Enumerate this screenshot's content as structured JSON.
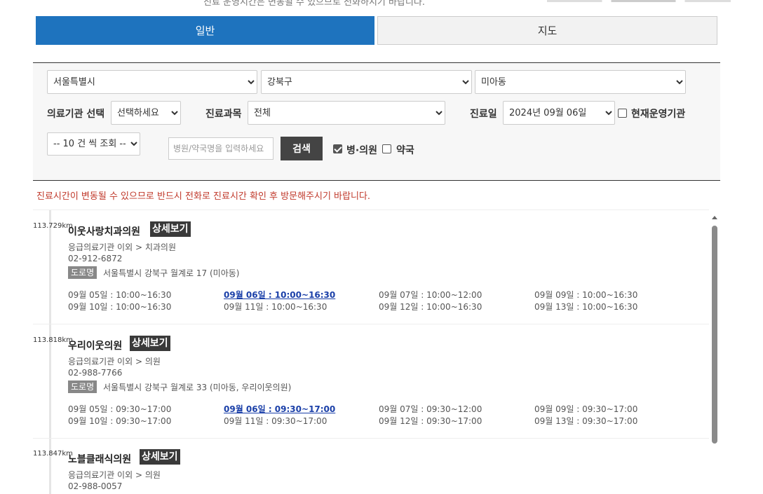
{
  "header": {
    "cut_text": "진료 운영시간은 변동될 수 있으므로 전화하시기 바랍니다."
  },
  "tabs": [
    {
      "label": "일반",
      "active": true
    },
    {
      "label": "지도",
      "active": false
    }
  ],
  "filters": {
    "sido": "서울특별시",
    "sigungu": "강북구",
    "dong": "미아동",
    "institution_label": "의료기관 선택",
    "institution_value": "선택하세요",
    "department_label": "진료과목",
    "department_value": "전체",
    "date_label": "진료일",
    "date_value": "2024년 09월 06일",
    "open_now_label": "현재운영기관",
    "page_size": "-- 10 건 씩 조회 --",
    "search_placeholder": "병원/약국명을 입력하세요",
    "search_button": "검색",
    "hospital_label": "병·의원",
    "pharmacy_label": "약국"
  },
  "notice": "진료시간이 변동될 수 있으므로 반드시 전화로 진료시간 확인 후 방문해주시기 바랍니다.",
  "detail_label": "상세보기",
  "road_tag": "도로명",
  "results": [
    {
      "distance": "113.729km",
      "name": "이웃사랑치과의원",
      "category": "응급의료기관 이외 > 치과의원",
      "phone": "02-912-6872",
      "address": "서울특별시 강북구 월계로 17 (미아동)",
      "schedule": [
        [
          "09월 05일 : 10:00~16:30",
          "09월 06일 : 10:00~16:30",
          "09월 07일 : 10:00~12:00",
          "09월 09일 : 10:00~16:30"
        ],
        [
          "09월 10일 : 10:00~16:30",
          "09월 11일 : 10:00~16:30",
          "09월 12일 : 10:00~16:30",
          "09월 13일 : 10:00~16:30"
        ]
      ]
    },
    {
      "distance": "113.818km",
      "name": "우리이웃의원",
      "category": "응급의료기관 이외 > 의원",
      "phone": "02-988-7766",
      "address": "서울특별시 강북구 월계로 33 (미아동, 우리이웃의원)",
      "schedule": [
        [
          "09월 05일 : 09:30~17:00",
          "09월 06일 : 09:30~17:00",
          "09월 07일 : 09:30~12:00",
          "09월 09일 : 09:30~17:00"
        ],
        [
          "09월 10일 : 09:30~17:00",
          "09월 11일 : 09:30~17:00",
          "09월 12일 : 09:30~17:00",
          "09월 13일 : 09:30~17:00"
        ]
      ]
    },
    {
      "distance": "113.847km",
      "name": "노블클래식의원",
      "category": "응급의료기관 이외 > 의원",
      "phone": "02-988-0057"
    }
  ]
}
